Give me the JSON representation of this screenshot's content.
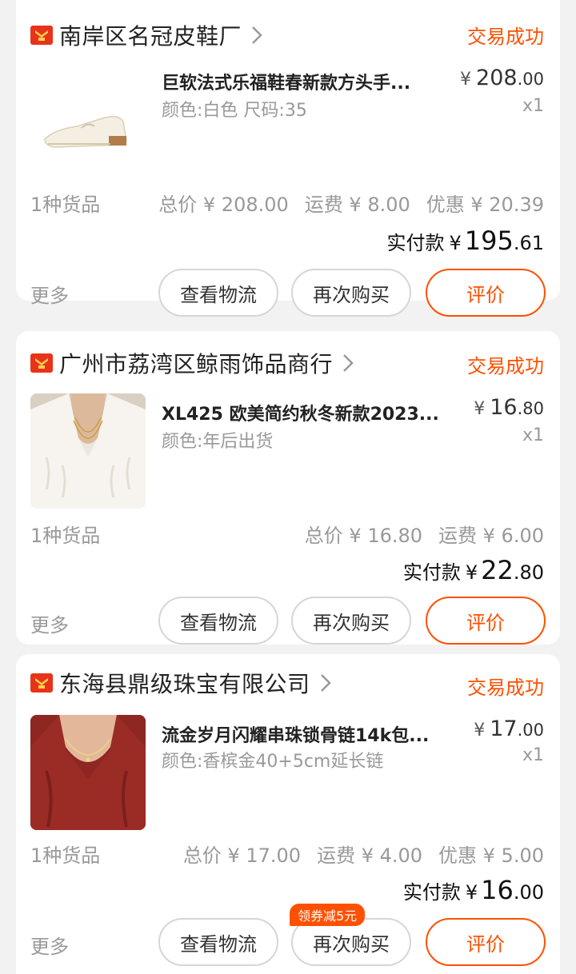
{
  "orders": [
    {
      "shop": "南岸区名冠皮鞋厂",
      "status": "交易成功",
      "title": "巨软法式乐福鞋春新款方头手...",
      "spec": "颜色:白色 尺码:35",
      "currency": "¥",
      "price_int": "208",
      "price_dec": ".00",
      "qty": "x1",
      "count": "1种货品",
      "total": "总价 ¥ 208.00",
      "shipping": "运费 ¥ 8.00",
      "discount": "优惠 ¥ 20.39",
      "paid_label": "实付款",
      "paid_int": "195",
      "paid_dec": ".61",
      "more": "更多",
      "btn_logistics": "查看物流",
      "btn_rebuy": "再次购买",
      "btn_review": "评价"
    },
    {
      "shop": "广州市荔湾区鲸雨饰品商行",
      "status": "交易成功",
      "title": "XL425 欧美简约秋冬新款2023...",
      "spec": "颜色:年后出货",
      "currency": "¥",
      "price_int": "16",
      "price_dec": ".80",
      "qty": "x1",
      "count": "1种货品",
      "total": "总价 ¥ 16.80",
      "shipping": "运费 ¥ 6.00",
      "paid_label": "实付款",
      "paid_int": "22",
      "paid_dec": ".80",
      "more": "更多",
      "btn_logistics": "查看物流",
      "btn_rebuy": "再次购买",
      "btn_review": "评价"
    },
    {
      "shop": "东海县鼎级珠宝有限公司",
      "status": "交易成功",
      "title": "流金岁月闪耀串珠锁骨链14k包...",
      "spec": "颜色:香槟金40+5cm延长链",
      "currency": "¥",
      "price_int": "17",
      "price_dec": ".00",
      "qty": "x1",
      "count": "1种货品",
      "total": "总价 ¥ 17.00",
      "shipping": "运费 ¥ 4.00",
      "discount": "优惠 ¥ 5.00",
      "paid_label": "实付款",
      "paid_int": "16",
      "paid_dec": ".00",
      "more": "更多",
      "coupon": "领券减5元",
      "btn_logistics": "查看物流",
      "btn_rebuy": "再次购买",
      "btn_review": "评价"
    }
  ],
  "icons": {
    "shop_logo": "shop-logo-icon",
    "chevron": "chevron-right-icon"
  },
  "colors": {
    "accent": "#ff5000",
    "logo": "#e8331b",
    "muted": "#999999"
  }
}
